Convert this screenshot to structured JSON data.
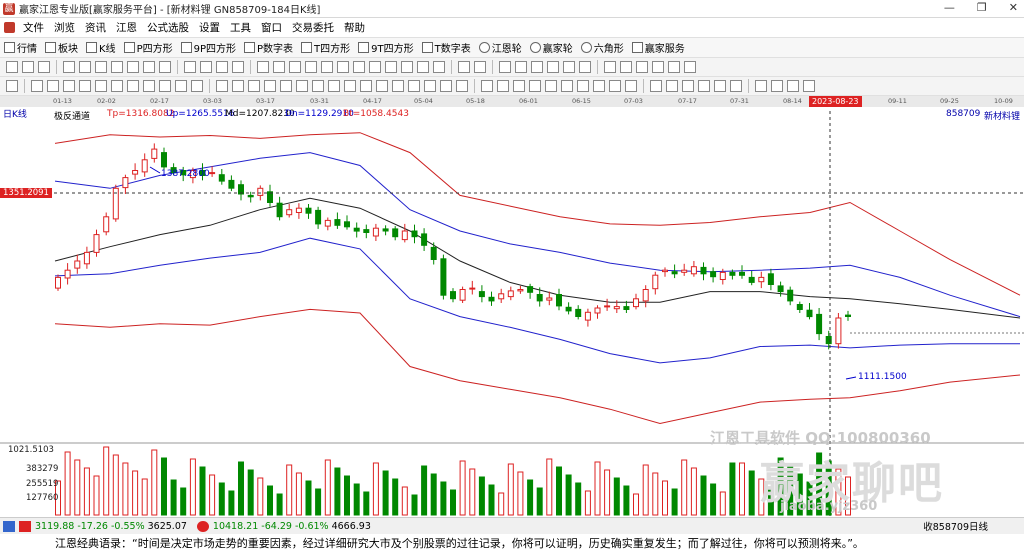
{
  "window": {
    "title": "赢家江恩专业版[赢家服务平台] - [新材料锂  GN858709-184日K线]",
    "min": "—",
    "max": "❐",
    "close": "✕"
  },
  "menu": [
    "文件",
    "浏览",
    "资讯",
    "江恩",
    "公式选股",
    "设置",
    "工具",
    "窗口",
    "交易委托",
    "帮助"
  ],
  "toolbar1": [
    "行情",
    "板块",
    "K线",
    "P四方形",
    "9P四方形",
    "P数字表",
    "T四方形",
    "9T四方形",
    "T数字表",
    "江恩轮",
    "赢家轮",
    "六角形",
    "赢家服务"
  ],
  "datebar": {
    "labels": [
      "01-13",
      "02-02",
      "02-17",
      "03-03",
      "03-17",
      "03-31",
      "04-17",
      "05-04",
      "05-18",
      "06-01",
      "06-15",
      "07-03",
      "07-17",
      "07-31",
      "08-14",
      "09-11",
      "09-25",
      "10-09"
    ],
    "highlight": "2023-08-23"
  },
  "chart": {
    "period": "日K线",
    "indicator": "极反通道",
    "tp": "Tp=1316.8082",
    "up": "Up=1265.5516",
    "md": "Md=1207.8230",
    "dn": "Dn=1129.2910",
    "bt": "Bt=1058.4543",
    "code": "858709",
    "name": "新材料锂",
    "high_label": "1387.2800",
    "low_label": "1111.1500",
    "current_price": "1351.2091",
    "vol_axis": [
      "1021.5103",
      "383279",
      "255519",
      "127760"
    ],
    "watermark1": "江恩工具软件   QQ:100800360",
    "watermark2": "赢家聊吧",
    "watermark3": "jiaoba.yjz360"
  },
  "status": {
    "sh_index": "3119.88",
    "sh_chg": "-17.26",
    "sh_pct": "-0.55%",
    "sh_amt": "3625.07",
    "sz_index": "10418.21",
    "sz_chg": "-64.29",
    "sz_pct": "-0.61%",
    "sz_amt": "4666.93",
    "right": "收858709日线"
  },
  "quote": "江恩经典语录：“时间是决定市场走势的重要因素，经过详细研究大市及个别股票的过往记录，你将可以证明，历史确实重复发生；而了解过往，你将可以预测将来。”。"
}
